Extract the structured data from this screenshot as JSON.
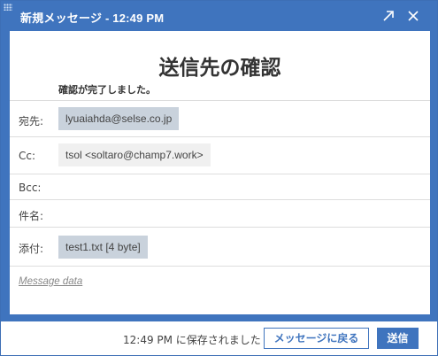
{
  "window": {
    "title": "新規メッセージ - 12:49 PM",
    "accent_color": "#3f74be",
    "controls": [
      "expand-icon",
      "close-icon"
    ]
  },
  "confirm": {
    "heading": "送信先の確認",
    "subheading": "確認が完了しました。"
  },
  "fields": {
    "to": {
      "label": "宛先:",
      "value": "lyuaiahda@selse.co.jp"
    },
    "cc": {
      "label": "Cc:",
      "value": "tsol <soltaro@champ7.work>"
    },
    "bcc": {
      "label": "Bcc:",
      "value": ""
    },
    "subject": {
      "label": "件名:",
      "value": ""
    },
    "attachment": {
      "label": "添付:",
      "value": "test1.txt [4 byte]"
    }
  },
  "message_link": "Message data",
  "footer": {
    "saved_status": "12:49 PM に保存されました",
    "back_button": "メッセージに戻る",
    "send_button": "送信"
  }
}
